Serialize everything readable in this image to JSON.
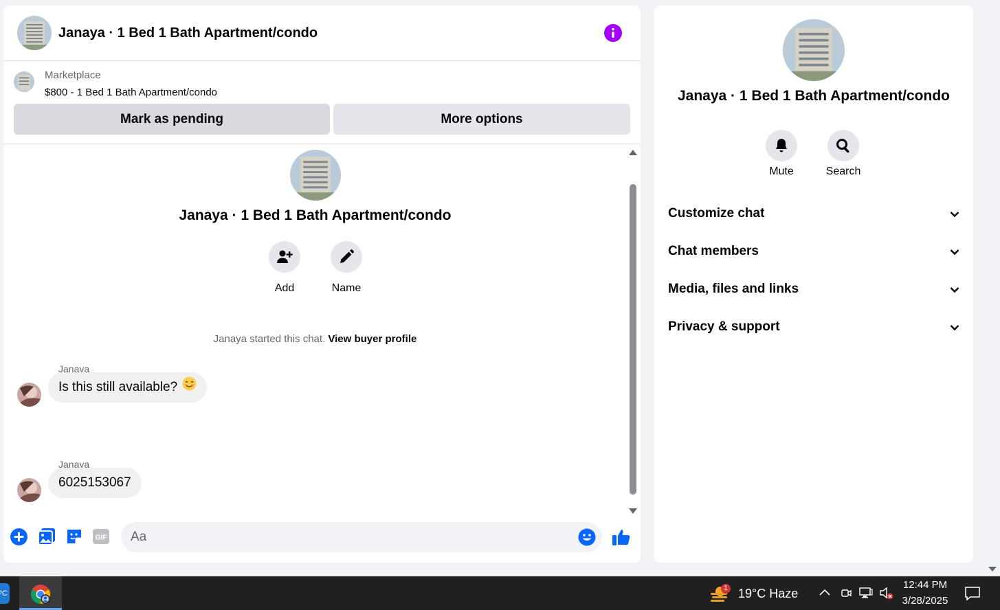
{
  "header": {
    "title": "Janaya · 1 Bed 1 Bath Apartment/condo",
    "info_icon": "info-icon"
  },
  "listing": {
    "label": "Marketplace",
    "price_title": "$800 - 1 Bed 1 Bath Apartment/condo",
    "mark_pending_label": "Mark as pending",
    "more_options_label": "More options"
  },
  "conversation": {
    "title": "Janaya · 1 Bed 1 Bath Apartment/condo",
    "add_label": "Add",
    "name_label": "Name",
    "started_text": "Janaya started this chat.",
    "view_profile_label": "View buyer profile",
    "messages": [
      {
        "sender": "Janaya",
        "text": "Is this still available?",
        "emoji": "smiling-face-icon"
      },
      {
        "sender": "Janaya",
        "text": "6025153067"
      }
    ]
  },
  "composer": {
    "placeholder": "Aa",
    "icons": [
      "add-circle-icon",
      "photo-icon",
      "sticker-icon",
      "gif-icon",
      "emoji-icon",
      "thumbs-up-icon"
    ],
    "gif_text": "GIF"
  },
  "info_panel": {
    "title": "Janaya · 1 Bed 1 Bath Apartment/condo",
    "mute_label": "Mute",
    "search_label": "Search",
    "sections": [
      "Customize chat",
      "Chat members",
      "Media, files and links",
      "Privacy & support"
    ]
  },
  "taskbar": {
    "pc_text": "PC",
    "weather_badge": "1",
    "weather": "19°C  Haze",
    "time": "12:44 PM",
    "date": "3/28/2025"
  },
  "colors": {
    "accent_blue": "#0866ff",
    "info_purple": "#a200ff",
    "taskbar": "#202020"
  }
}
